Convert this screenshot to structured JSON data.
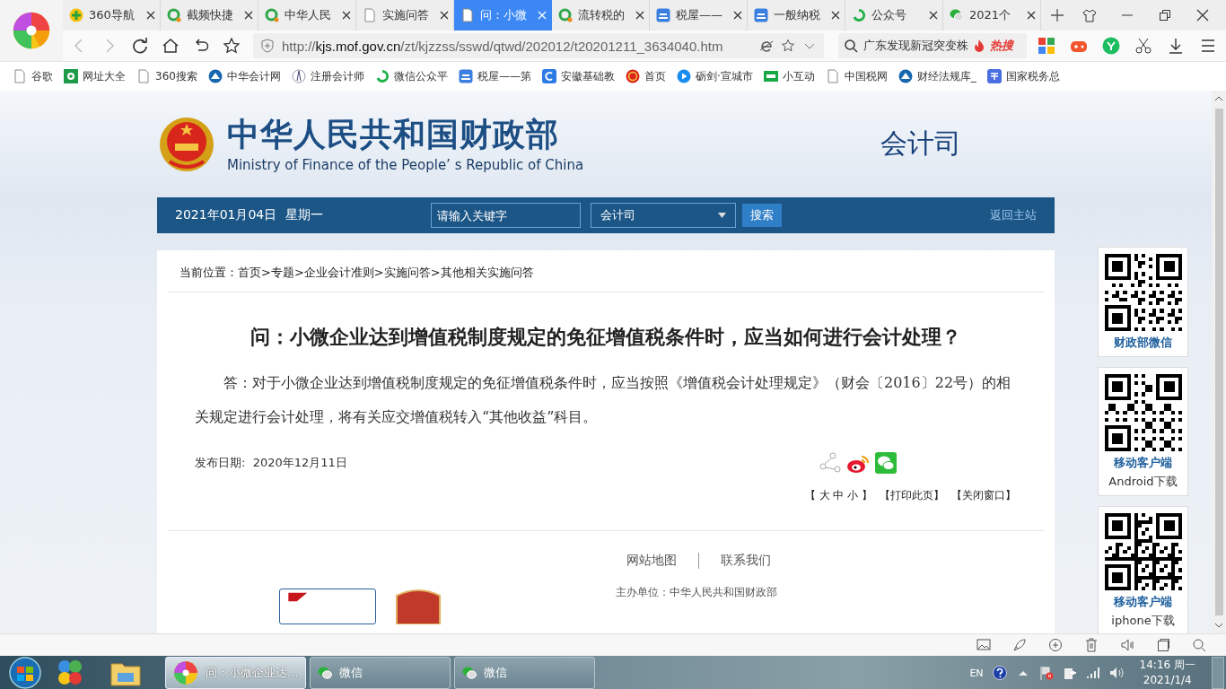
{
  "browser": {
    "tabs": [
      {
        "title": "360导航",
        "kind": "nav360",
        "selected": false
      },
      {
        "title": "截频快捷",
        "kind": "ring",
        "selected": false
      },
      {
        "title": "中华人民",
        "kind": "ring",
        "selected": false
      },
      {
        "title": "实施问答",
        "kind": "page",
        "selected": false
      },
      {
        "title": "问：小微",
        "kind": "page",
        "selected": true
      },
      {
        "title": "流转税的",
        "kind": "ring",
        "selected": false
      },
      {
        "title": "税屋——",
        "kind": "shuiwu",
        "selected": false
      },
      {
        "title": "一般纳税",
        "kind": "shuiwu",
        "selected": false
      },
      {
        "title": "公众号",
        "kind": "swirl",
        "selected": false
      },
      {
        "title": "2021个",
        "kind": "wechat",
        "selected": false
      }
    ],
    "address": {
      "scheme": "http://",
      "host": "kjs.mof.gov.cn",
      "path": "/zt/kjzzss/sswd/qtwd/202012/t20201211_3634040.htm"
    },
    "search": {
      "value": "广东发现新冠突变株",
      "hot": "热搜"
    },
    "bookmarks": [
      {
        "title": "谷歌",
        "kind": "page"
      },
      {
        "title": "网址大全",
        "kind": "flower"
      },
      {
        "title": "360搜索",
        "kind": "page"
      },
      {
        "title": "中华会计网",
        "kind": "peak"
      },
      {
        "title": "注册会计师",
        "kind": "compass"
      },
      {
        "title": "微信公众平",
        "kind": "swirl"
      },
      {
        "title": "税屋——第",
        "kind": "shuiwu"
      },
      {
        "title": "安徽基础教",
        "kind": "cshape"
      },
      {
        "title": "首页",
        "kind": "emblem"
      },
      {
        "title": "砺剑·宣城市",
        "kind": "play"
      },
      {
        "title": "小互动",
        "kind": "greenbox"
      },
      {
        "title": "中国税网",
        "kind": "page"
      },
      {
        "title": "财经法规库_",
        "kind": "peak"
      },
      {
        "title": "国家税务总",
        "kind": "tax"
      }
    ]
  },
  "header": {
    "title": "中华人民共和国财政部",
    "subtitle": "Ministry of Finance of the People’ s Republic of China",
    "department": "会计司"
  },
  "navbar": {
    "date": "2021年01月04日",
    "weekday": "星期一",
    "search_placeholder": "请输入关键字",
    "scope": "会计司",
    "search_button": "搜索",
    "home_link": "返回主站"
  },
  "breadcrumb": "当前位置：首页>专题>企业会计准则>实施问答>其他相关实施问答",
  "article": {
    "title": "问：小微企业达到增值税制度规定的免征增值税条件时，应当如何进行会计处理？",
    "body": "答：对于小微企业达到增值税制度规定的免征增值税条件时，应当按照《增值税会计处理规定》（财会〔2016〕22号）的相关规定进行会计处理，将有关应交增值税转入“其他收益”科目。",
    "publish_label": "发布日期:",
    "publish_date": "2020年12月11日",
    "tools": [
      "【 大 中 小 】",
      "【打印此页】",
      "【关闭窗口】"
    ]
  },
  "footer": {
    "links": [
      "网站地图",
      "联系我们"
    ],
    "host": "主办单位：中华人民共和国财政部"
  },
  "side_cards": [
    {
      "label": "财政部微信"
    },
    {
      "label": "移动客户端",
      "sublabel": "Android下载"
    },
    {
      "label": "移动客户端",
      "sublabel": "iphone下载"
    }
  ],
  "taskbar": {
    "items": [
      {
        "label": "问：小微企业达...",
        "kind": "browser",
        "selected": true
      },
      {
        "label": "微信",
        "kind": "wechat",
        "selected": false
      },
      {
        "label": "微信",
        "kind": "wechat",
        "selected": false
      }
    ],
    "language": "EN",
    "time": "14:16 周一",
    "date": "2021/1/4"
  }
}
